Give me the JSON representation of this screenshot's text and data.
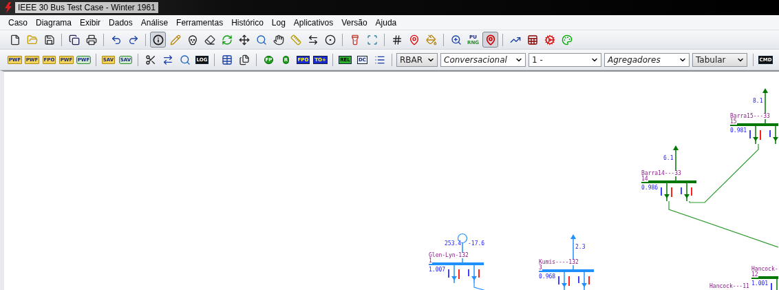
{
  "window": {
    "title": "IEEE 30 Bus Test Case - Winter 1961"
  },
  "menu": [
    "Caso",
    "Diagrama",
    "Exibir",
    "Dados",
    "Análise",
    "Ferramentas",
    "Histórico",
    "Log",
    "Aplicativos",
    "Versão",
    "Ajuda"
  ],
  "toolbar_1": [
    [
      {
        "kind": "icon",
        "pressed": false
      },
      {
        "kind": "icon",
        "pressed": false
      },
      {
        "kind": "icon",
        "pressed": false
      }
    ],
    [
      {
        "kind": "icon",
        "pressed": false
      },
      {
        "kind": "icon",
        "pressed": false
      }
    ],
    [
      {
        "kind": "icon",
        "pressed": false
      },
      {
        "kind": "icon",
        "pressed": false
      }
    ],
    [
      {
        "kind": "icon",
        "pressed": true
      },
      {
        "kind": "icon",
        "pressed": false
      },
      {
        "kind": "icon",
        "pressed": false
      },
      {
        "kind": "icon",
        "pressed": false
      },
      {
        "kind": "icon",
        "pressed": false
      },
      {
        "kind": "icon",
        "pressed": false
      },
      {
        "kind": "icon",
        "pressed": false
      },
      {
        "kind": "icon",
        "pressed": false
      },
      {
        "kind": "icon",
        "pressed": false
      },
      {
        "kind": "icon",
        "pressed": false
      },
      {
        "kind": "icon",
        "pressed": false
      }
    ],
    [
      {
        "kind": "icon",
        "pressed": false
      },
      {
        "kind": "icon",
        "pressed": false
      }
    ],
    [
      {
        "kind": "icon",
        "pressed": false
      },
      {
        "kind": "icon",
        "pressed": false
      },
      {
        "kind": "icon",
        "pressed": false
      }
    ],
    [
      {
        "kind": "icon",
        "pressed": false
      },
      {
        "kind": "text",
        "pressed": false,
        "label_top": "PU",
        "label_bottom": "RNG"
      },
      {
        "kind": "icon",
        "pressed": true
      }
    ],
    [
      {
        "kind": "icon",
        "pressed": false
      },
      {
        "kind": "icon",
        "pressed": false
      },
      {
        "kind": "icon",
        "pressed": false
      },
      {
        "kind": "icon",
        "pressed": false
      }
    ]
  ],
  "toolbar_2": {
    "icon_labels": [
      "PWF",
      "PWF",
      "FPO",
      "PWF",
      "PWF",
      "SAV",
      "SAV",
      "LOG",
      "FP",
      "R",
      "FPO",
      "TO+",
      "REL",
      "DC",
      "CMD"
    ],
    "dropdowns": [
      {
        "value": "RBAR",
        "editable": false,
        "italic": false
      },
      {
        "value": "Conversacional",
        "editable": true,
        "italic": true
      },
      {
        "value": "1 -",
        "editable": true,
        "italic": false
      },
      {
        "value": "Agregadores",
        "editable": true,
        "italic": true
      },
      {
        "value": "Tabular",
        "editable": false,
        "italic": false
      }
    ]
  },
  "diagram": {
    "buses": [
      {
        "name": "Barra15---33",
        "number": "15",
        "voltage": "0.981",
        "color": "#007700",
        "injection": {
          "kind": "load",
          "value": "8.1"
        }
      },
      {
        "name": "Barra14---33",
        "number": "14",
        "voltage": "0.986",
        "color": "#007700",
        "injection": {
          "kind": "load",
          "value": "6.1"
        }
      },
      {
        "name": "Glen-Lyn-132",
        "number": "1",
        "voltage": "1.007",
        "color": "#1e90ff",
        "injection": {
          "kind": "generator",
          "value": "253.4",
          "value_2": "-17.6"
        }
      },
      {
        "name": "Kumis----132",
        "number": "3",
        "voltage": "0.968",
        "color": "#1e90ff",
        "injection": {
          "kind": "load",
          "value": "2.3"
        }
      },
      {
        "name": "Hancock-",
        "number": "12",
        "voltage": "1.001",
        "color": "#007700"
      }
    ],
    "labels": [
      "Hancock---11"
    ]
  }
}
